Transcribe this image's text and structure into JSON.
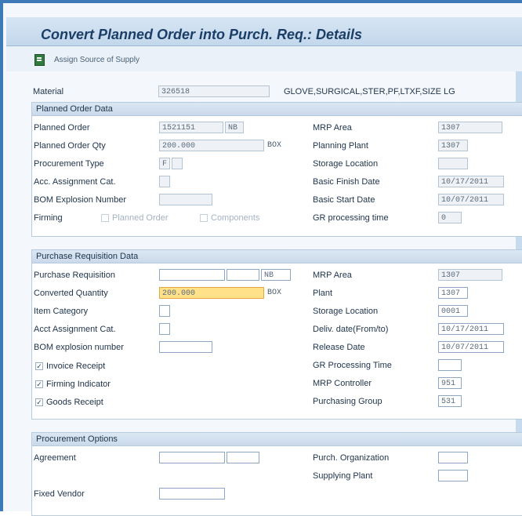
{
  "title": "Convert Planned Order into Purch. Req.: Details",
  "toolbar": {
    "assign_label": "Assign Source of Supply"
  },
  "material": {
    "label": "Material",
    "value": "326518",
    "description": "GLOVE,SURGICAL,STER,PF,LTXF,SIZE LG"
  },
  "planned": {
    "header": "Planned Order Data",
    "left": {
      "planned_order": {
        "label": "Planned Order",
        "value": "1521151",
        "type": "NB"
      },
      "planned_order_qty": {
        "label": "Planned Order Qty",
        "value": "200.000",
        "unit": "BOX"
      },
      "procurement_type": {
        "label": "Procurement Type",
        "value": "F"
      },
      "acc_assignment": {
        "label": "Acc. Assignment Cat."
      },
      "bom_explosion": {
        "label": "BOM Explosion Number"
      },
      "firming": {
        "label": "Firming",
        "opt1": "Planned Order",
        "opt2": "Components"
      }
    },
    "right": {
      "mrp_area": {
        "label": "MRP Area",
        "value": "1307"
      },
      "planning_plant": {
        "label": "Planning Plant",
        "value": "1307"
      },
      "storage_location": {
        "label": "Storage Location",
        "value": ""
      },
      "basic_finish": {
        "label": "Basic Finish Date",
        "value": "10/17/2011"
      },
      "basic_start": {
        "label": "Basic Start Date",
        "value": "10/07/2011"
      },
      "gr_time": {
        "label": "GR processing time",
        "value": "0"
      }
    }
  },
  "purchase": {
    "header": "Purchase Requisition Data",
    "left": {
      "purchase_req": {
        "label": "Purchase Requisition",
        "type": "NB"
      },
      "converted_qty": {
        "label": "Converted Quantity",
        "value": "200.000",
        "unit": "BOX"
      },
      "item_category": {
        "label": "Item Category"
      },
      "acct_assignment": {
        "label": "Acct Assignment Cat."
      },
      "bom_explosion": {
        "label": "BOM explosion number"
      },
      "invoice_receipt": {
        "label": "Invoice Receipt",
        "checked": true
      },
      "firming_indicator": {
        "label": "Firming Indicator",
        "checked": true
      },
      "goods_receipt": {
        "label": "Goods Receipt",
        "checked": true
      }
    },
    "right": {
      "mrp_area": {
        "label": "MRP Area",
        "value": "1307"
      },
      "plant": {
        "label": "Plant",
        "value": "1307"
      },
      "storage_location": {
        "label": "Storage Location",
        "value": "0001"
      },
      "deliv_date": {
        "label": "Deliv. date(From/to)",
        "value": "10/17/2011"
      },
      "release_date": {
        "label": "Release Date",
        "value": "10/07/2011"
      },
      "gr_time": {
        "label": "GR Processing Time",
        "value": ""
      },
      "mrp_controller": {
        "label": "MRP Controller",
        "value": "951"
      },
      "purchasing_group": {
        "label": "Purchasing Group",
        "value": "531"
      }
    }
  },
  "procurement": {
    "header": "Procurement Options",
    "agreement": {
      "label": "Agreement"
    },
    "fixed_vendor": {
      "label": "Fixed Vendor"
    },
    "purch_org": {
      "label": "Purch. Organization"
    },
    "supplying_plant": {
      "label": "Supplying Plant"
    }
  }
}
